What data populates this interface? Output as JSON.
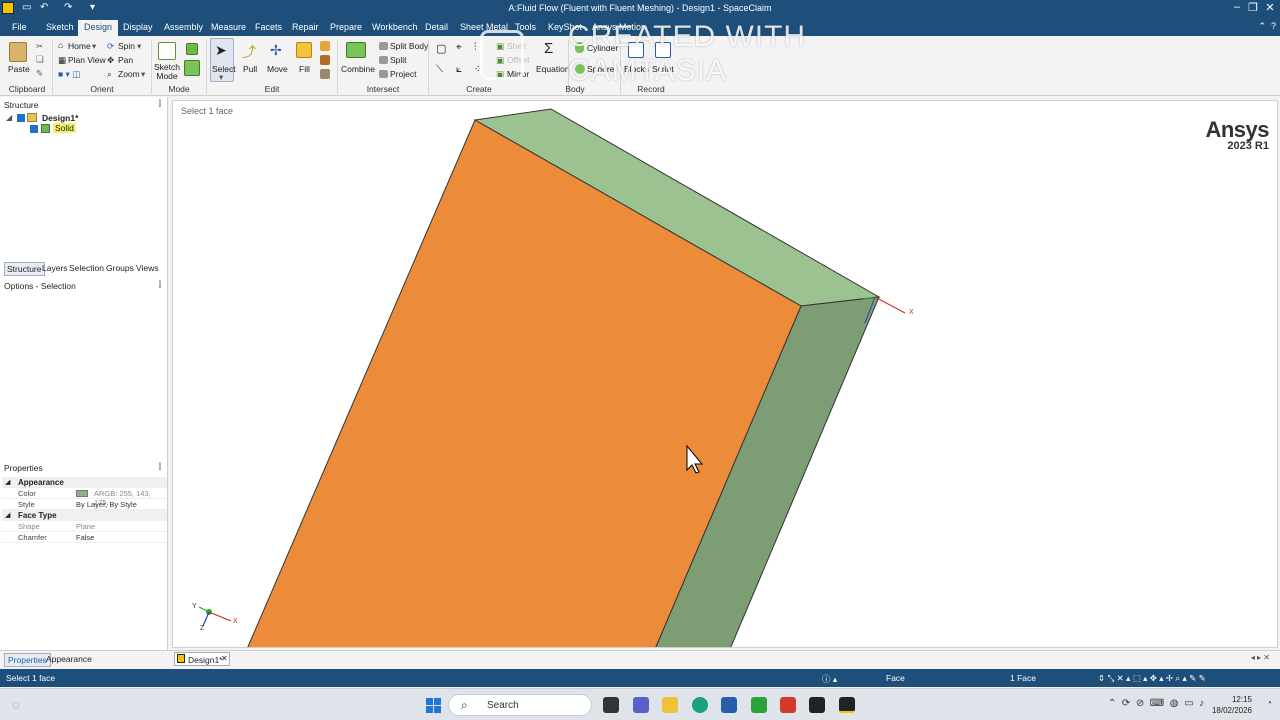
{
  "window": {
    "title": "A:Fluid Flow (Fluent with Fluent Meshing) - Design1 - SpaceClaim"
  },
  "menu_tabs": [
    {
      "label": "File",
      "active": false
    },
    {
      "label": "Sketch",
      "active": false
    },
    {
      "label": "Design",
      "active": true
    },
    {
      "label": "Display",
      "active": false
    },
    {
      "label": "Assembly",
      "active": false
    },
    {
      "label": "Measure",
      "active": false
    },
    {
      "label": "Facets",
      "active": false
    },
    {
      "label": "Repair",
      "active": false
    },
    {
      "label": "Prepare",
      "active": false
    },
    {
      "label": "Workbench",
      "active": false
    },
    {
      "label": "Detail",
      "active": false
    },
    {
      "label": "Sheet Metal",
      "active": false
    },
    {
      "label": "Tools",
      "active": false
    },
    {
      "label": "KeyShot",
      "active": false
    },
    {
      "label": "Ansys Motion",
      "active": false
    }
  ],
  "ribbon": {
    "clipboard": {
      "paste": "Paste",
      "group": "Clipboard"
    },
    "orient": {
      "home": "Home",
      "plan_view": "Plan View",
      "spin": "Spin",
      "pan": "Pan",
      "zoom": "Zoom",
      "group": "Orient"
    },
    "mode": {
      "sketch_mode": "Sketch Mode",
      "group": "Mode"
    },
    "edit": {
      "select": "Select",
      "pull": "Pull",
      "move": "Move",
      "fill": "Fill",
      "group": "Edit"
    },
    "intersect": {
      "combine": "Combine",
      "split_body": "Split Body",
      "split": "Split",
      "project": "Project",
      "group": "Intersect"
    },
    "create": {
      "shell": "Shell",
      "offset": "Offset",
      "mirror": "Mirror",
      "equation": "Equation",
      "group": "Create"
    },
    "body": {
      "cylinder": "Cylinder",
      "sphere": "Sphere",
      "group": "Body"
    },
    "record": {
      "blocks": "Blocks",
      "script": "Script",
      "group": "Record"
    }
  },
  "watermark": {
    "line1": "CREATED WITH",
    "line2": "CAMTASIA"
  },
  "structure_panel": {
    "header": "Structure",
    "tree": [
      {
        "label": "Design1*",
        "level": 0
      },
      {
        "label": "Solid",
        "level": 1
      }
    ],
    "tabs": [
      "Structure",
      "Layers",
      "Selection",
      "Groups",
      "Views"
    ]
  },
  "options_panel": {
    "header": "Options - Selection"
  },
  "properties_panel": {
    "header": "Properties",
    "rows": [
      {
        "type": "category",
        "key": "Appearance"
      },
      {
        "type": "row",
        "key": "Color",
        "value": "ARGB: 255, 143, 175,"
      },
      {
        "type": "row",
        "key": "Style",
        "value": "By Layer, By Style"
      },
      {
        "type": "category",
        "key": "Face Type"
      },
      {
        "type": "row",
        "key": "Shape",
        "value": "Plane"
      },
      {
        "type": "row",
        "key": "Chamfer",
        "value": "False"
      }
    ],
    "tabs": [
      "Properties",
      "Appearance"
    ]
  },
  "viewport": {
    "hint": "Select 1 face",
    "brand": "Ansys",
    "version": "2023 R1",
    "axis_labels": {
      "x": "X",
      "y": "Y",
      "z": "Z"
    }
  },
  "document_tab": "Design1*",
  "statusbar": {
    "left": "Select 1 face",
    "filter": "Face",
    "selection_count": "1 Face"
  },
  "taskbar": {
    "search_placeholder": "Search",
    "time": "12:15",
    "date": "18/02/2026"
  },
  "colors": {
    "title_bar": "#1e4f7a",
    "selected_face": "#ec8c3a",
    "top_face": "#9dc292",
    "side_face": "#7d9e74"
  }
}
